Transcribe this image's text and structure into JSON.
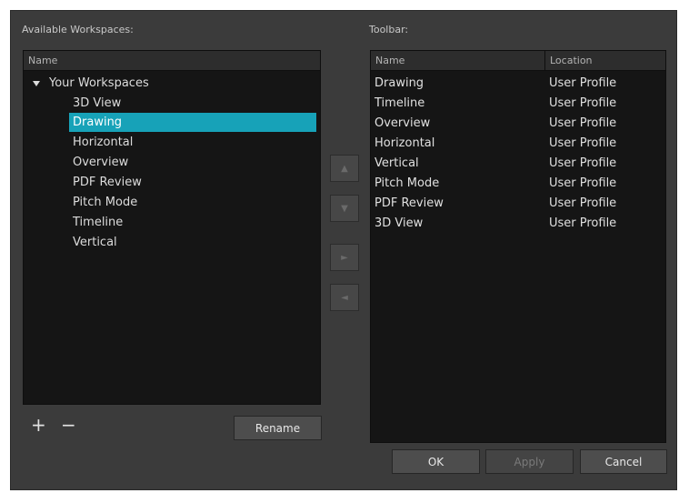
{
  "left": {
    "title": "Available Workspaces:",
    "column_header": "Name",
    "group_label": "Your Workspaces",
    "items": [
      "3D View",
      "Drawing",
      "Horizontal",
      "Overview",
      "PDF Review",
      "Pitch Mode",
      "Timeline",
      "Vertical"
    ],
    "selected_item": "Drawing",
    "add_label": "+",
    "remove_label": "−",
    "rename_label": "Rename"
  },
  "right": {
    "title": "Toolbar:",
    "columns": [
      "Name",
      "Location"
    ],
    "rows": [
      {
        "name": "Drawing",
        "location": "User Profile"
      },
      {
        "name": "Timeline",
        "location": "User Profile"
      },
      {
        "name": "Overview",
        "location": "User Profile"
      },
      {
        "name": "Horizontal",
        "location": "User Profile"
      },
      {
        "name": "Vertical",
        "location": "User Profile"
      },
      {
        "name": "Pitch Mode",
        "location": "User Profile"
      },
      {
        "name": "PDF Review",
        "location": "User Profile"
      },
      {
        "name": "3D View",
        "location": "User Profile"
      }
    ]
  },
  "arrows": {
    "up": "▲",
    "down": "▼",
    "right": "►",
    "left": "◄"
  },
  "footer": {
    "ok_label": "OK",
    "apply_label": "Apply",
    "cancel_label": "Cancel"
  },
  "colors": {
    "selection": "#17a2b8",
    "dialog_bg": "#3b3b3b",
    "panel_bg": "#151515"
  }
}
